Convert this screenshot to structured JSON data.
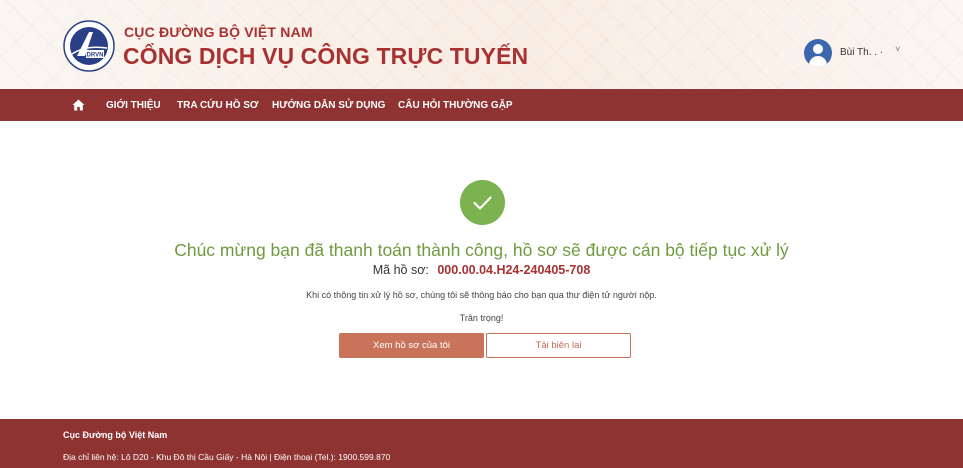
{
  "header": {
    "brand_top": "CỤC ĐƯỜNG BỘ VIỆT NAM",
    "brand_main": "CỔNG DỊCH VỤ CÔNG TRỰC TUYẾN",
    "logo_text": "DRVN",
    "user_name": "Bùi Th. . ·",
    "user_chevron": "˅"
  },
  "nav": {
    "home_icon": "home-icon",
    "items": [
      {
        "label": "GIỚI THIỆU"
      },
      {
        "label": "TRA CỨU HỒ SƠ"
      },
      {
        "label": "HƯỚNG DẪN SỬ DỤNG"
      },
      {
        "label": "CÂU HỎI THƯỜNG GẶP"
      }
    ]
  },
  "main": {
    "success_icon": "check-circle-icon",
    "headline": "Chúc mừng bạn đã thanh toán thành công, hồ sơ sẽ được cán bộ tiếp tục xử lý",
    "code_label": "Mã hồ sơ:",
    "code_value": "000.00.04.H24-240405-708",
    "info": "Khi có thông tin xử lý hồ sơ, chúng tôi sẽ thông báo cho bạn qua thư điện tử người nộp.",
    "regards": "Trân trọng!",
    "view_button": "Xem hồ sơ của tôi",
    "receipt_button": "Tải biên lai"
  },
  "footer": {
    "title": "Cục Đường bộ Việt Nam",
    "contact": "Địa chỉ liên hệ: Lô D20 - Khu Đô thị Cầu Giấy - Hà Nội | Điện thoại (Tel.): 1900.599.870"
  },
  "colors": {
    "brand_red": "#a83232",
    "nav_bg": "#8f3232",
    "success_green": "#7cb24f",
    "headline_green": "#6f9b3f",
    "button_primary": "#c9735a"
  }
}
